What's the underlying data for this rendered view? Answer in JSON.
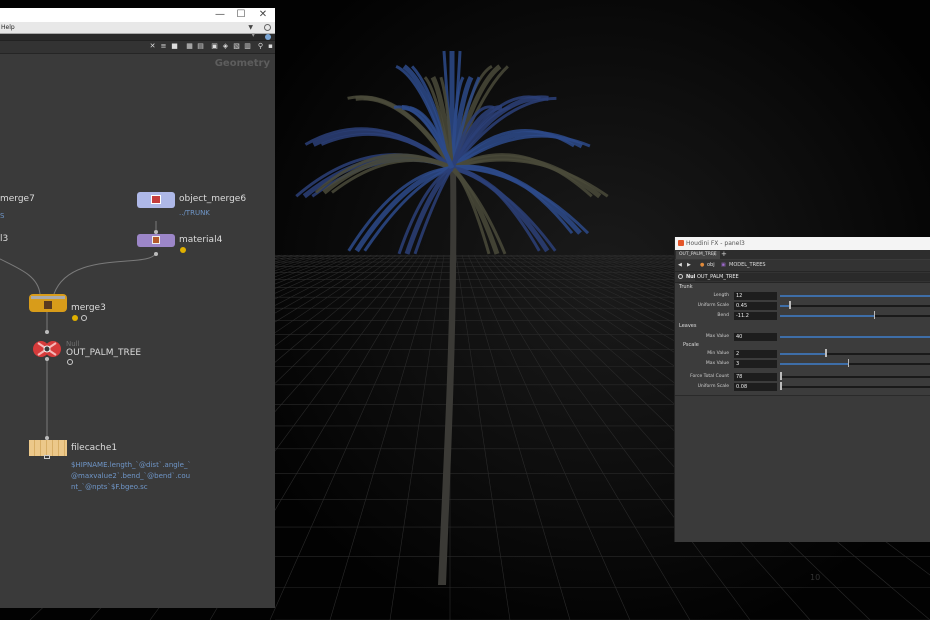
{
  "node_editor": {
    "menubar": {
      "help": "Help"
    },
    "context_label": "Geometry",
    "nodes": {
      "merge7": {
        "name": "merge7",
        "sub": "S"
      },
      "object_merge6": {
        "name": "object_merge6",
        "sub": "../TRUNK"
      },
      "clipped_left": {
        "name": "l3"
      },
      "material4": {
        "name": "material4"
      },
      "merge3": {
        "name": "merge3"
      },
      "out_palm_tree": {
        "type": "Null",
        "name": "OUT_PALM_TREE"
      },
      "filecache1": {
        "name": "filecache1",
        "expression_lines": [
          "$HIPNAME.length_`@dist`.angle_`",
          "@maxvalue2`.bend_`@bend`.cou",
          "nt_`@npts`$F.bgeo.sc"
        ]
      }
    }
  },
  "floating_panel": {
    "title": "Houdini FX - panel3",
    "tab": "OUT_PALM_TREE",
    "path": {
      "root": "obj",
      "node": "MODEL_TREES"
    },
    "node_type": "Null",
    "node_name": "OUT_PALM_TREE",
    "folders": {
      "trunk": "Trunk",
      "leaves": "Leaves",
      "pscale": "Pscale"
    },
    "params": [
      {
        "label": "Length",
        "value": "12",
        "fill": 1.0
      },
      {
        "label": "Uniform Scale",
        "value": "0.45",
        "fill": 0.06
      },
      {
        "label": "Bend",
        "value": "-11.2",
        "fill": 0.62
      },
      {
        "label": "Max Value",
        "value": "40",
        "fill": 1.0
      },
      {
        "label": "Min Value",
        "value": "2",
        "fill": 0.3
      },
      {
        "label": "Max Value",
        "value": "3",
        "fill": 0.45
      },
      {
        "label": "Force Total Count",
        "value": "78",
        "fill": 0.0
      },
      {
        "label": "Uniform Scale",
        "value": "0.08",
        "fill": 0.0
      }
    ]
  },
  "viewport": {
    "grid_labels": [
      "10"
    ]
  }
}
